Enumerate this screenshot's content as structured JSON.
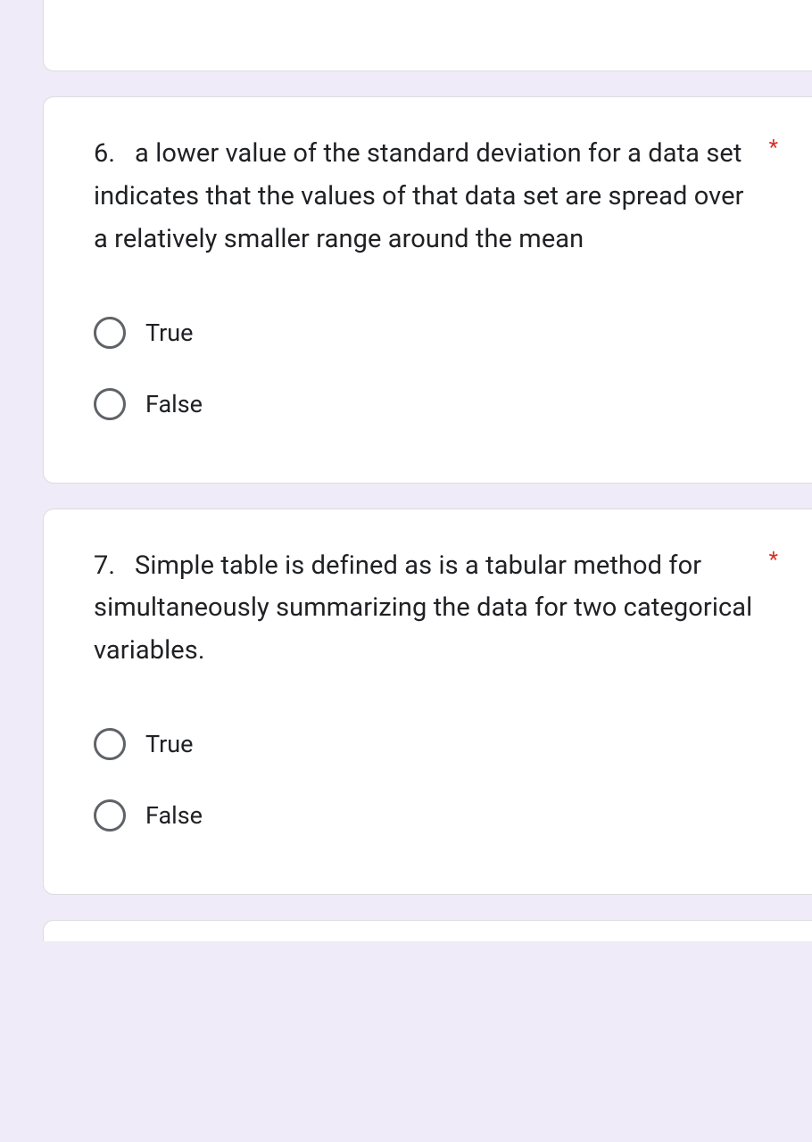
{
  "questions": [
    {
      "number": "6.",
      "text": "a lower value of the standard deviation for a data set indicates that the values of that data set are spread over a relatively smaller range around the mean",
      "required": "*",
      "options": [
        "True",
        "False"
      ]
    },
    {
      "number": "7.",
      "text": "Simple table is defined as is a tabular method for simultaneously summarizing the data for two categorical variables.",
      "required": "*",
      "options": [
        "True",
        "False"
      ]
    }
  ]
}
